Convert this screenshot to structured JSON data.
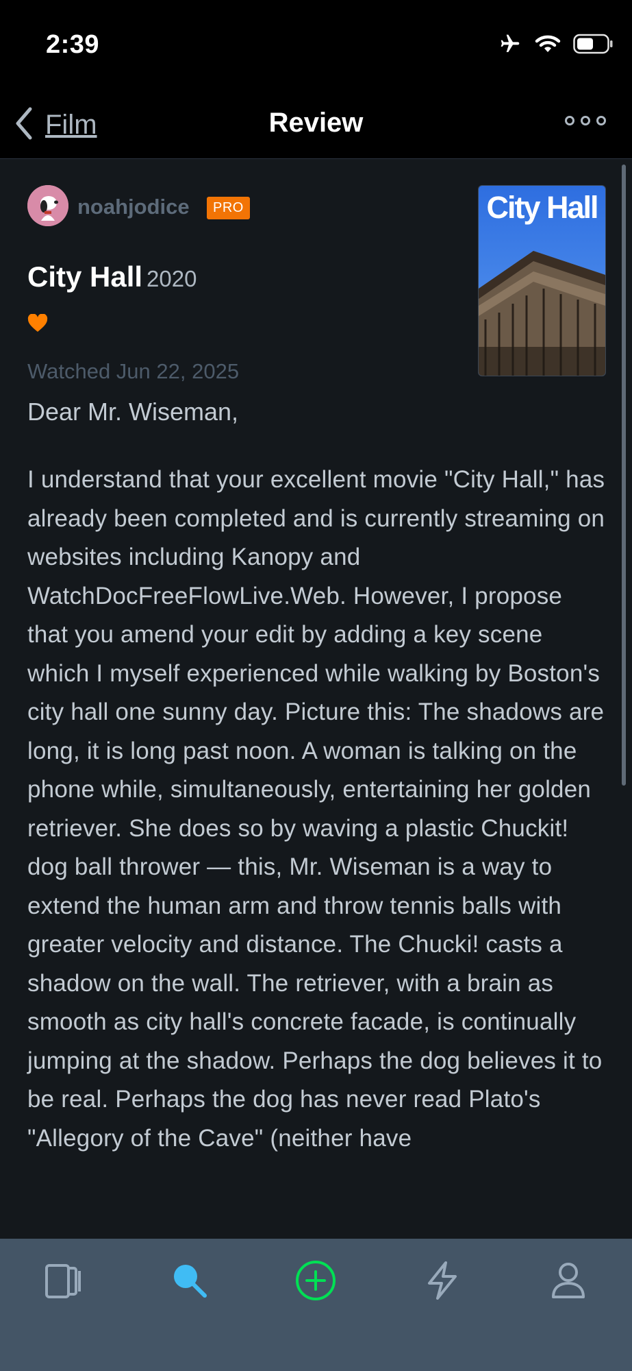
{
  "status_bar": {
    "time": "2:39",
    "icons": [
      "airplane-icon",
      "wifi-icon",
      "battery-icon"
    ]
  },
  "nav": {
    "back_label": "Film",
    "title": "Review",
    "more_icon": "more-icon"
  },
  "review": {
    "username": "noahjodice",
    "badge": "PRO",
    "film_title": "City Hall",
    "film_year": "2020",
    "liked": true,
    "watched_date": "Watched Jun 22, 2025",
    "poster_title": "City Hall",
    "salutation": "Dear Mr. Wiseman,",
    "body": "I understand that your excellent movie \"City Hall,\" has already been completed and is currently streaming on websites including Kanopy and WatchDocFreeFlowLive.Web. However, I propose that you amend your edit by adding a key scene which I myself experienced while walking by Boston's city hall one sunny day. Picture this: The shadows are long, it is long past noon. A woman is talking on the phone while, simultaneously, entertaining her golden retriever. She does so by waving a plastic Chuckit! dog ball thrower — this, Mr. Wiseman is a way to extend the human arm and throw tennis balls with greater velocity and distance. The Chucki! casts a shadow on the wall. The retriever, with a brain as smooth as city hall's concrete facade, is continually jumping at the shadow. Perhaps the dog believes it to be real. Perhaps the dog has never read Plato's \"Allegory of the Cave\" (neither have"
  },
  "tab_bar": {
    "items": [
      {
        "icon": "films-icon",
        "active": false
      },
      {
        "icon": "search-icon",
        "active": true
      },
      {
        "icon": "add-icon",
        "active": false
      },
      {
        "icon": "activity-icon",
        "active": false
      },
      {
        "icon": "profile-icon",
        "active": false
      }
    ]
  },
  "colors": {
    "background": "#14181c",
    "pro_badge": "#f27405",
    "heart": "#ff8000",
    "search_active": "#40bcf4",
    "add_green": "#00e054",
    "tab_bar": "#445566"
  }
}
